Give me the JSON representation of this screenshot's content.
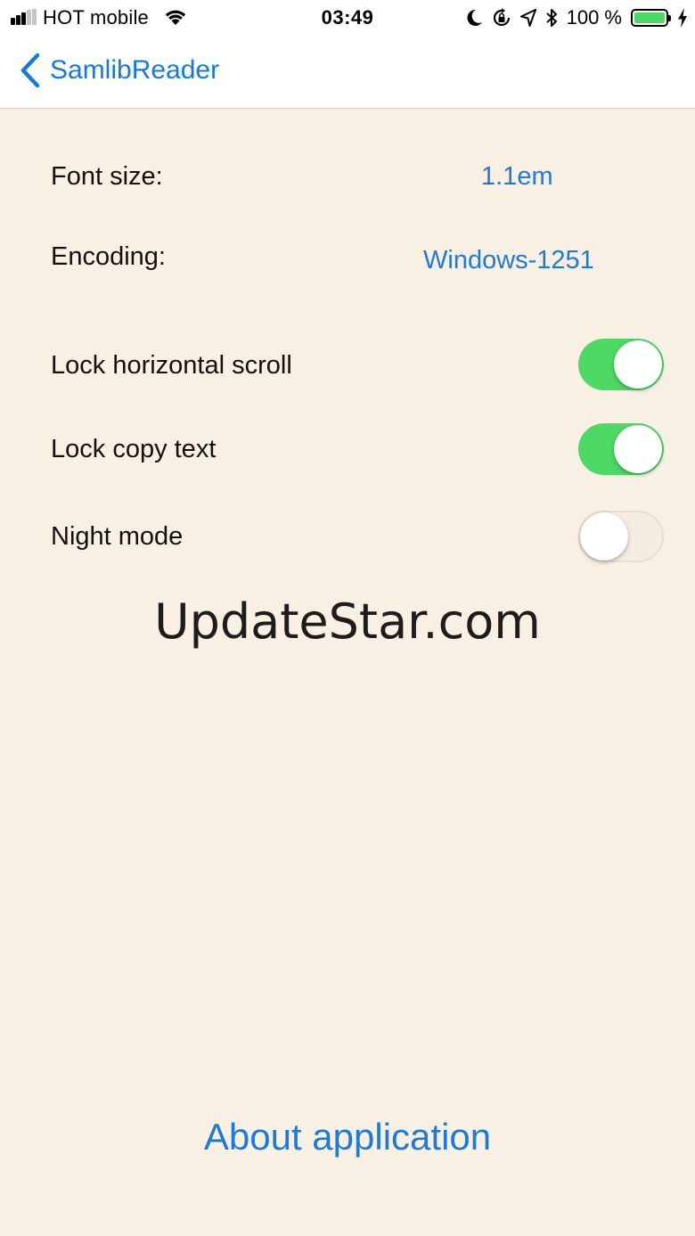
{
  "status_bar": {
    "carrier": "HOT mobile",
    "time": "03:49",
    "battery_percent": "100 %",
    "battery_level": 1.0,
    "signal_bars_active": 3,
    "signal_bars_total": 5,
    "icons": [
      "wifi-icon",
      "moon-icon",
      "rotation-lock-icon",
      "location-arrow-icon",
      "bluetooth-icon",
      "battery-icon",
      "charging-bolt-icon"
    ]
  },
  "nav": {
    "back_label": "SamlibReader",
    "back_icon": "chevron-left-icon"
  },
  "settings": {
    "font_size": {
      "label": "Font size:",
      "value": "1.1em"
    },
    "encoding": {
      "label": "Encoding:",
      "value": "Windows-1251"
    },
    "lock_horizontal_scroll": {
      "label": "Lock horizontal scroll",
      "on": true
    },
    "lock_copy_text": {
      "label": "Lock copy text",
      "on": true
    },
    "night_mode": {
      "label": "Night mode",
      "on": false
    }
  },
  "watermark": "UpdateStar.com",
  "about_label": "About application",
  "colors": {
    "accent": "#1e7ad8",
    "background": "#f9f0e4",
    "toggle_on": "#4cd964",
    "nav_background": "#ffffff"
  }
}
